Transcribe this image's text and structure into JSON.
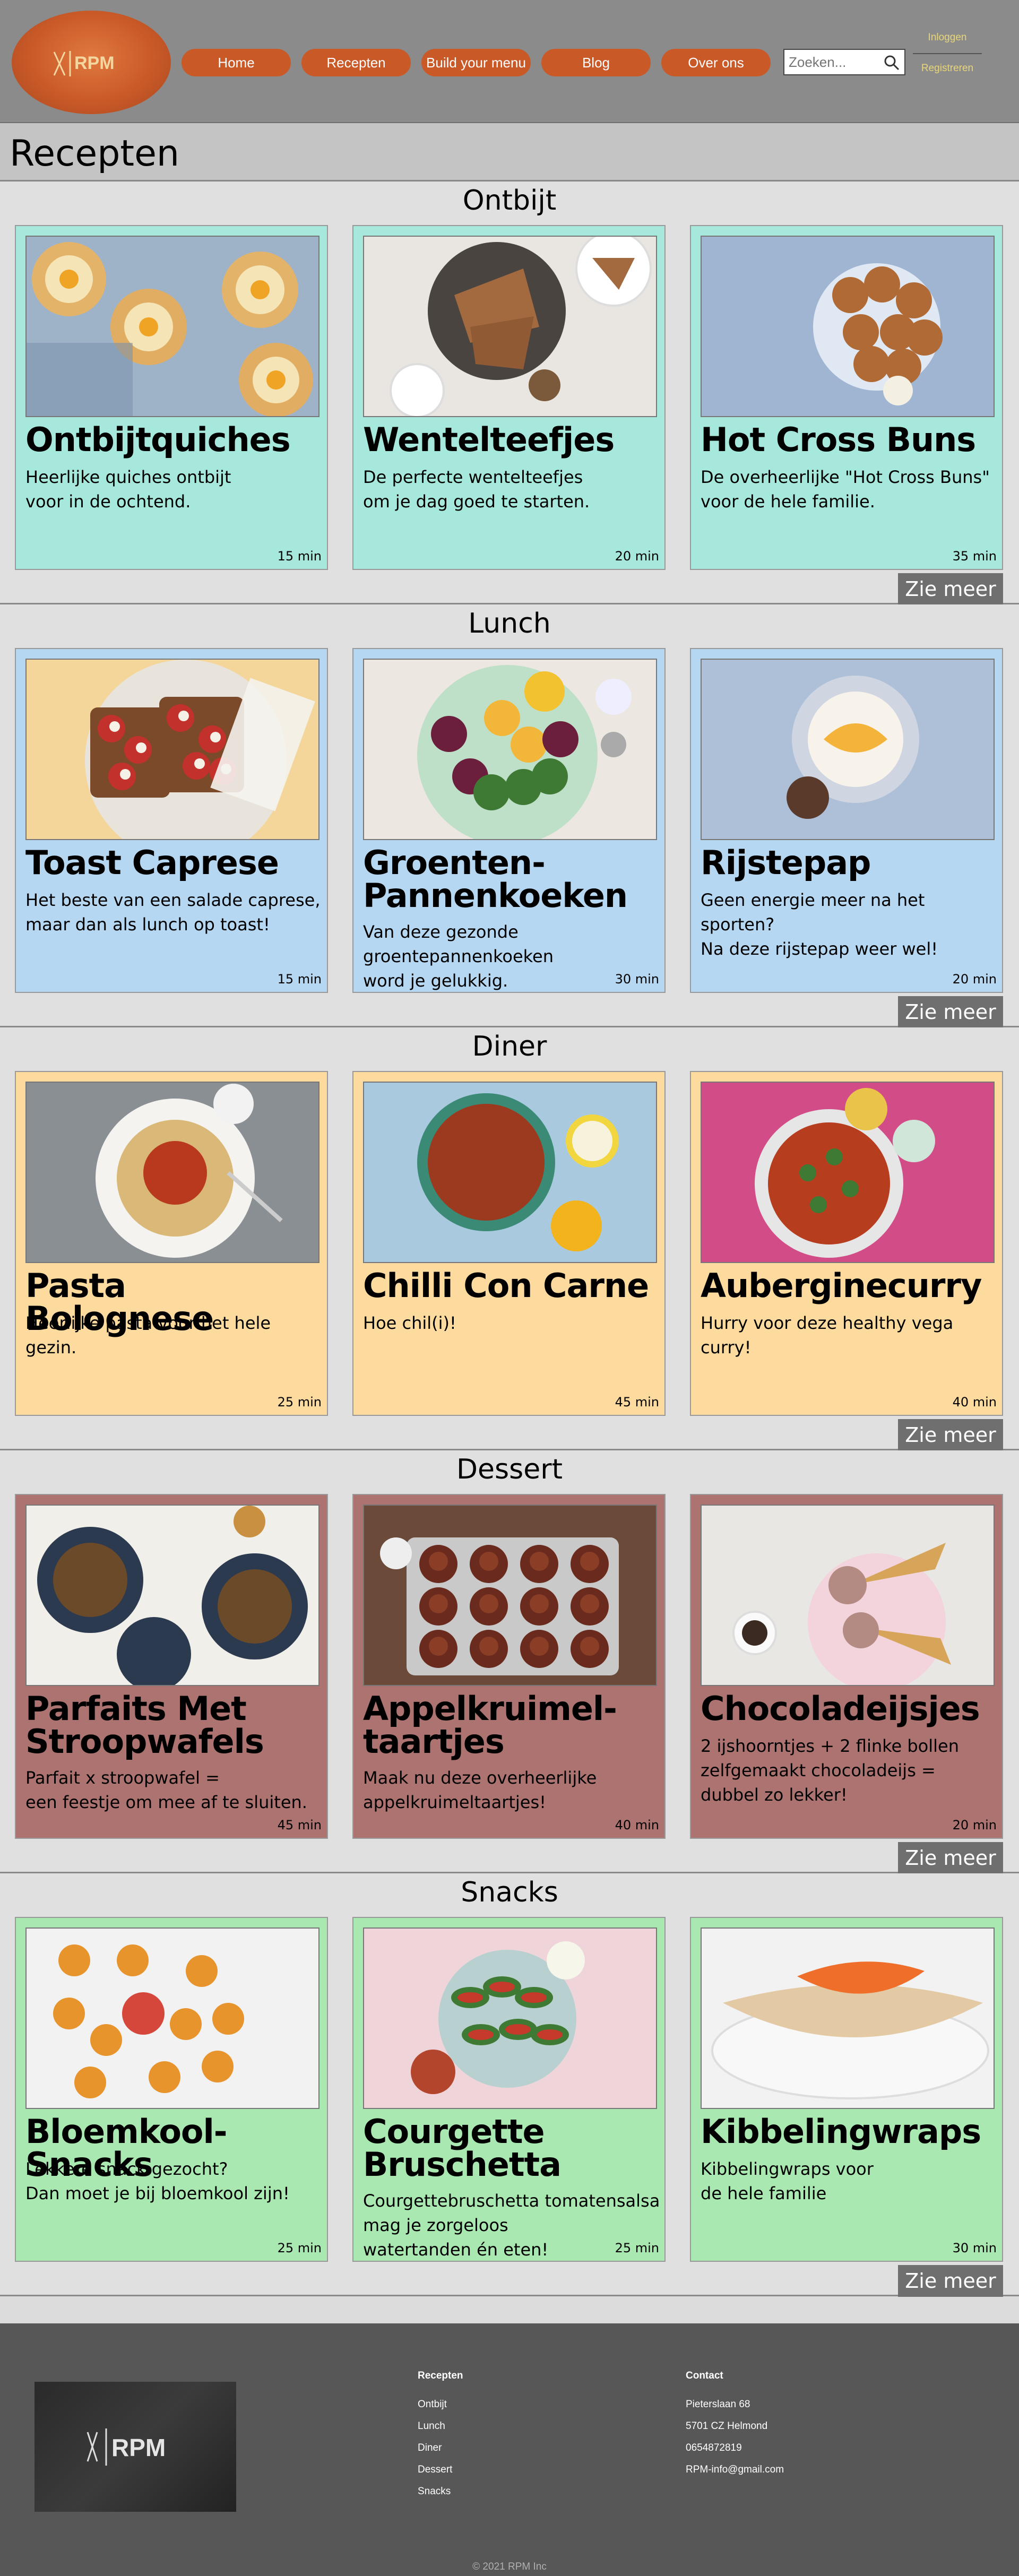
{
  "header": {
    "logo_text": "RPM",
    "nav": [
      "Home",
      "Recepten",
      "Build your menu",
      "Blog",
      "Over ons"
    ],
    "search_placeholder": "Zoeken...",
    "login": "Inloggen",
    "register": "Registreren"
  },
  "page": {
    "title": "Recepten"
  },
  "colors": {
    "header_bg": "#8b8b8b",
    "accent": "#c95a28",
    "ontbijt_card": "#a7e8dc",
    "lunch_card": "#b6d7f2",
    "diner_card": "#fdda9e",
    "dessert_card": "#ac7371",
    "snacks_card": "#a9e8b0",
    "footer_bg": "#575757"
  },
  "more_label": "Zie meer",
  "sections": [
    {
      "title": "Ontbijt",
      "cards": [
        {
          "title": "Ontbijtquiches",
          "desc": [
            "Heerlijke quiches ontbijt",
            "voor in de ochtend."
          ],
          "time": "15 min",
          "image": "egg-quiches"
        },
        {
          "title": "Wentelteefjes",
          "desc": [
            "De perfecte wentelteefjes",
            "om je dag goed te starten."
          ],
          "time": "20 min",
          "image": "french-toast"
        },
        {
          "title": "Hot Cross Buns",
          "desc": [
            "De overheerlijke \"Hot Cross Buns\"",
            "voor de hele familie."
          ],
          "time": "35 min",
          "image": "buns"
        }
      ]
    },
    {
      "title": "Lunch",
      "cards": [
        {
          "title": "Toast Caprese",
          "desc": [
            "Het beste van een salade caprese,",
            "maar dan als lunch op toast!"
          ],
          "time": "15 min",
          "image": "toast"
        },
        {
          "title": "Groenten-",
          "title2": "Pannenkoeken",
          "desc": [
            "Van deze gezonde",
            "groentepannenkoeken",
            "word je gelukkig."
          ],
          "time": "30 min",
          "image": "pancakes"
        },
        {
          "title": "Rijstepap",
          "desc": [
            "Geen energie meer na het sporten?",
            "Na deze rijstepap weer wel!"
          ],
          "time": "20 min",
          "image": "rice-pudding"
        }
      ]
    },
    {
      "title": "Diner",
      "cards": [
        {
          "title": "Pasta Bolognese",
          "desc": [
            "Heerlijke pasta voor het hele gezin."
          ],
          "time": "25 min",
          "image": "pasta"
        },
        {
          "title": "Chilli Con Carne",
          "desc": [
            "Hoe chil(i)!"
          ],
          "time": "45 min",
          "image": "chili"
        },
        {
          "title": "Auberginecurry",
          "desc": [
            "Hurry voor deze healthy vega curry!"
          ],
          "time": "40 min",
          "image": "curry"
        }
      ]
    },
    {
      "title": "Dessert",
      "cards": [
        {
          "title": "Parfaits Met",
          "title2": "Stroopwafels",
          "desc": [
            "Parfait x stroopwafel =",
            "een feestje om mee af te sluiten."
          ],
          "time": "45 min",
          "image": "parfaits"
        },
        {
          "title": "Appelkruimel-",
          "title2": "taartjes",
          "desc": [
            "Maak nu deze overheerlijke",
            "appelkruimeltaartjes!"
          ],
          "time": "40 min",
          "image": "tarts"
        },
        {
          "title": "Chocoladeijsjes",
          "desc": [
            "2 ijshoorntjes + 2 flinke bollen",
            "zelfgemaakt chocoladeijs =",
            "dubbel zo lekker!"
          ],
          "time": "20 min",
          "image": "ice-cream"
        }
      ]
    },
    {
      "title": "Snacks",
      "cards": [
        {
          "title": "Bloemkool-Snacks",
          "desc": [
            "Lekkere snack gezocht?",
            "Dan moet je bij bloemkool zijn!"
          ],
          "time": "25 min",
          "image": "cauliflower-bites"
        },
        {
          "title": "Courgette",
          "title2": "Bruschetta",
          "desc": [
            "Courgettebruschetta tomatensalsa",
            "mag je zorgeloos",
            "watertanden én eten!"
          ],
          "time": "25 min",
          "image": "zucchini"
        },
        {
          "title": "Kibbelingwraps",
          "desc": [
            "Kibbelingwraps voor",
            "de hele familie"
          ],
          "time": "30 min",
          "image": "wrap"
        }
      ]
    }
  ],
  "footer": {
    "recipes_heading": "Recepten",
    "recipes": [
      "Ontbijt",
      "Lunch",
      "Diner",
      "Dessert",
      "Snacks"
    ],
    "contact_heading": "Contact",
    "contact": [
      "Pieterslaan 68",
      "5701 CZ Helmond",
      "0654872819",
      "RPM-info@gmail.com"
    ],
    "copyright": "©    2021    RPM Inc"
  }
}
